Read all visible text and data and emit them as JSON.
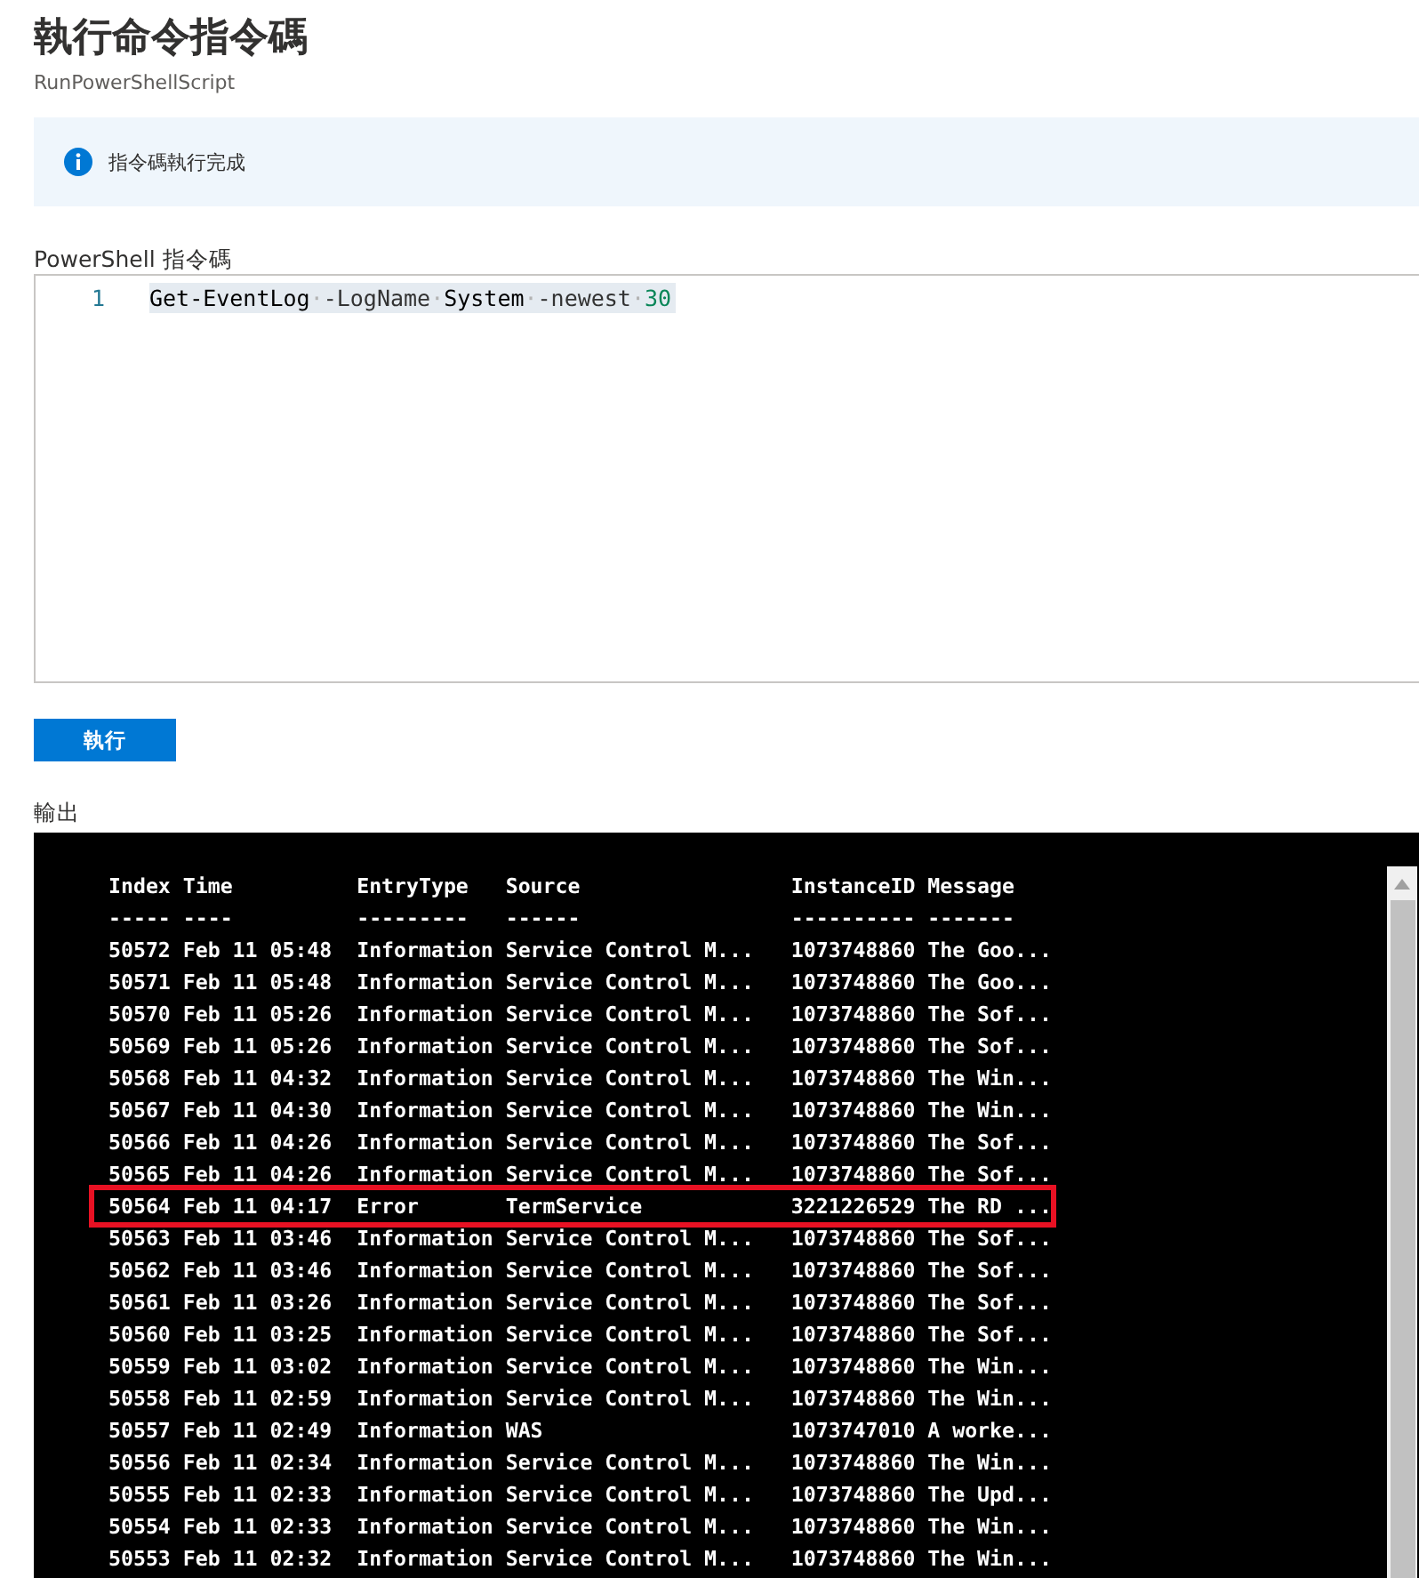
{
  "page": {
    "title": "執行命令指令碼",
    "subtitle": "RunPowerShellScript"
  },
  "banner": {
    "kind": "info",
    "message": "指令碼執行完成"
  },
  "editor": {
    "label": "PowerShell 指令碼",
    "lines": [
      {
        "number": "1",
        "tokens": [
          {
            "kind": "command",
            "text": "Get-EventLog"
          },
          {
            "kind": "whitespace",
            "text": "·"
          },
          {
            "kind": "parameter",
            "text": "-LogName"
          },
          {
            "kind": "whitespace",
            "text": "·"
          },
          {
            "kind": "command",
            "text": "System"
          },
          {
            "kind": "whitespace",
            "text": "·"
          },
          {
            "kind": "parameter",
            "text": "-newest"
          },
          {
            "kind": "whitespace",
            "text": "·"
          },
          {
            "kind": "number",
            "text": "30"
          }
        ]
      }
    ]
  },
  "run_button": {
    "label": "執行"
  },
  "output": {
    "label": "輸出",
    "columns": [
      {
        "label": "Index",
        "underline": "-----"
      },
      {
        "label": "Time",
        "underline": "----"
      },
      {
        "label": "EntryType",
        "underline": "---------"
      },
      {
        "label": "Source",
        "underline": "------"
      },
      {
        "label": "InstanceID",
        "underline": "----------"
      },
      {
        "label": "Message",
        "underline": "-------"
      }
    ],
    "rows": [
      {
        "cells": [
          "50572",
          "Feb 11 05:48",
          "Information",
          "Service Control M...",
          "1073748860",
          "The Goo..."
        ],
        "highlighted": false
      },
      {
        "cells": [
          "50571",
          "Feb 11 05:48",
          "Information",
          "Service Control M...",
          "1073748860",
          "The Goo..."
        ],
        "highlighted": false
      },
      {
        "cells": [
          "50570",
          "Feb 11 05:26",
          "Information",
          "Service Control M...",
          "1073748860",
          "The Sof..."
        ],
        "highlighted": false
      },
      {
        "cells": [
          "50569",
          "Feb 11 05:26",
          "Information",
          "Service Control M...",
          "1073748860",
          "The Sof..."
        ],
        "highlighted": false
      },
      {
        "cells": [
          "50568",
          "Feb 11 04:32",
          "Information",
          "Service Control M...",
          "1073748860",
          "The Win..."
        ],
        "highlighted": false
      },
      {
        "cells": [
          "50567",
          "Feb 11 04:30",
          "Information",
          "Service Control M...",
          "1073748860",
          "The Win..."
        ],
        "highlighted": false
      },
      {
        "cells": [
          "50566",
          "Feb 11 04:26",
          "Information",
          "Service Control M...",
          "1073748860",
          "The Sof..."
        ],
        "highlighted": false
      },
      {
        "cells": [
          "50565",
          "Feb 11 04:26",
          "Information",
          "Service Control M...",
          "1073748860",
          "The Sof..."
        ],
        "highlighted": false
      },
      {
        "cells": [
          "50564",
          "Feb 11 04:17",
          "Error",
          "TermService",
          "3221226529",
          "The RD ..."
        ],
        "highlighted": true
      },
      {
        "cells": [
          "50563",
          "Feb 11 03:46",
          "Information",
          "Service Control M...",
          "1073748860",
          "The Sof..."
        ],
        "highlighted": false
      },
      {
        "cells": [
          "50562",
          "Feb 11 03:46",
          "Information",
          "Service Control M...",
          "1073748860",
          "The Sof..."
        ],
        "highlighted": false
      },
      {
        "cells": [
          "50561",
          "Feb 11 03:26",
          "Information",
          "Service Control M...",
          "1073748860",
          "The Sof..."
        ],
        "highlighted": false
      },
      {
        "cells": [
          "50560",
          "Feb 11 03:25",
          "Information",
          "Service Control M...",
          "1073748860",
          "The Sof..."
        ],
        "highlighted": false
      },
      {
        "cells": [
          "50559",
          "Feb 11 03:02",
          "Information",
          "Service Control M...",
          "1073748860",
          "The Win..."
        ],
        "highlighted": false
      },
      {
        "cells": [
          "50558",
          "Feb 11 02:59",
          "Information",
          "Service Control M...",
          "1073748860",
          "The Win..."
        ],
        "highlighted": false
      },
      {
        "cells": [
          "50557",
          "Feb 11 02:49",
          "Information",
          "WAS",
          "1073747010",
          "A worke..."
        ],
        "highlighted": false
      },
      {
        "cells": [
          "50556",
          "Feb 11 02:34",
          "Information",
          "Service Control M...",
          "1073748860",
          "The Win..."
        ],
        "highlighted": false
      },
      {
        "cells": [
          "50555",
          "Feb 11 02:33",
          "Information",
          "Service Control M...",
          "1073748860",
          "The Upd..."
        ],
        "highlighted": false
      },
      {
        "cells": [
          "50554",
          "Feb 11 02:33",
          "Information",
          "Service Control M...",
          "1073748860",
          "The Win..."
        ],
        "highlighted": false
      },
      {
        "cells": [
          "50553",
          "Feb 11 02:32",
          "Information",
          "Service Control M...",
          "1073748860",
          "The Win..."
        ],
        "highlighted": false
      }
    ]
  }
}
